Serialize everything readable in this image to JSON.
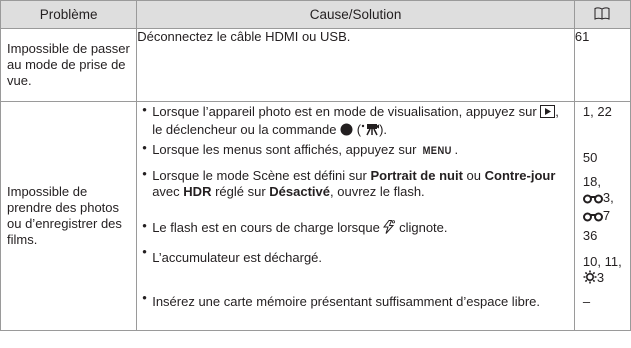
{
  "header": {
    "problem": "Problème",
    "cause": "Cause/Solution",
    "ref_icon": "book-icon"
  },
  "row1": {
    "problem": "Impossible de passer au mode de prise de vue.",
    "solution": "Déconnectez le câble HDMI ou USB.",
    "ref": "61"
  },
  "row2": {
    "problem": "Impossible de prendre des photos ou d’enregistrer des films.",
    "s1_a": "Lorsque l’appareil photo est en mode de visualisation, appuyez sur",
    "s1_b": ", le déclencheur ou la commande",
    "s1_c": "(",
    "s1_d": ").",
    "s2_a": "Lorsque les menus sont affichés, appuyez sur",
    "s2_menu": "MENU",
    "s2_b": ".",
    "s3_a": "Lorsque le mode Scène est défini sur",
    "s3_b1": "Portrait de nuit",
    "s3_c": "ou",
    "s3_b2": "Contre-jour",
    "s3_d": "avec",
    "s3_b3": "HDR",
    "s3_e": "réglé sur",
    "s3_b4": "Désactivé",
    "s3_f": ", ouvrez le flash.",
    "s4_a": "Le flash est en cours de charge lorsque",
    "s4_b": "clignote.",
    "s5": "L’accumulateur est déchargé.",
    "s6": "Insérez une carte mémoire présentant suffisamment d’espace libre.",
    "r1": "1, 22",
    "r2": "50",
    "r3_a": "18,",
    "r3_b": "3,",
    "r3_c": "7",
    "r4": "36",
    "r5_a": "10, 11,",
    "r5_b": "3",
    "r6": "–"
  },
  "icons": {
    "play": "playback-button-icon",
    "record": "movie-record-button-icon",
    "movie": "movie-icon",
    "flash": "flash-lamp-icon",
    "reference": "reference-section-icon",
    "tips": "tips-section-icon"
  }
}
